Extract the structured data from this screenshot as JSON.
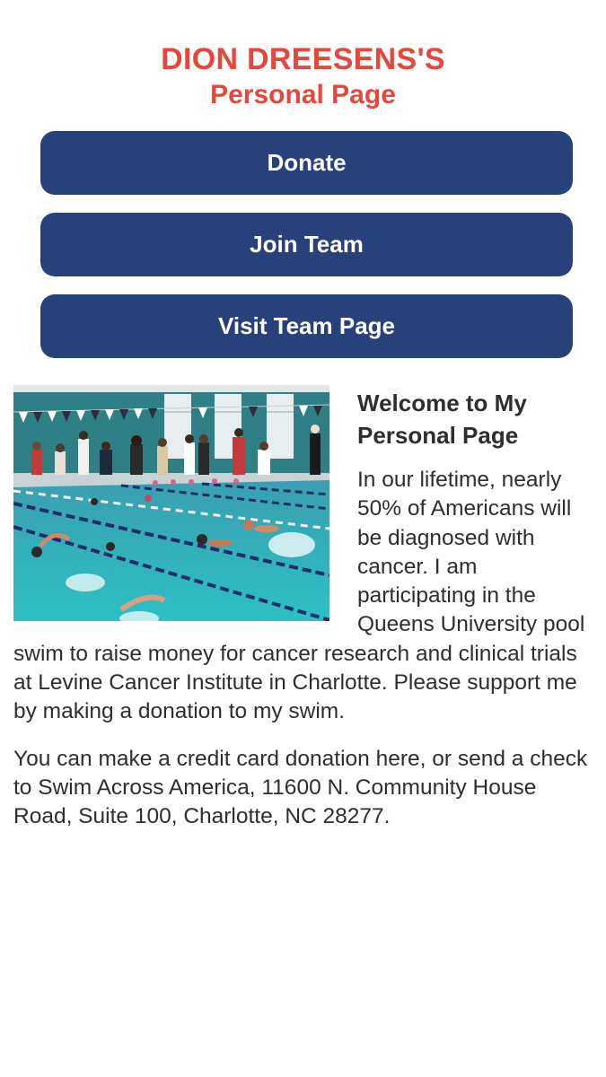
{
  "header": {
    "title": "DION DREESENS'S",
    "subtitle": "Personal Page"
  },
  "buttons": {
    "donate": "Donate",
    "join_team": "Join Team",
    "visit_team_page": "Visit Team Page"
  },
  "content": {
    "heading": "Welcome to My Personal Page",
    "paragraph1": "In our lifetime, nearly 50% of Americans will be diagnosed with cancer. I am participating in the Queens University pool swim to raise money for cancer research and clinical trials at Levine Cancer Institute in Charlotte. Please support me by making a donation to my swim.",
    "paragraph2": "You can make a credit card donation here, or send a check to Swim Across America, 11600 N. Community House Road, Suite 100, Charlotte, NC 28277."
  },
  "colors": {
    "title_red": "#e5473b",
    "button_navy": "#27417b",
    "pool_water": "#2fb3b8"
  }
}
